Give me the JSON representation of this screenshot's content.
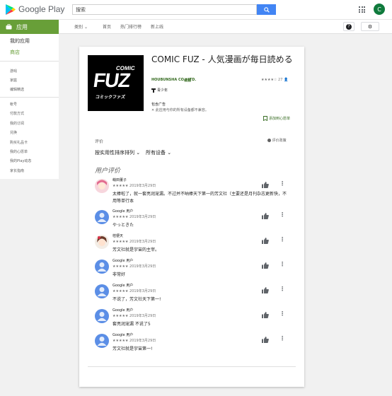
{
  "header": {
    "brand": "Google Play",
    "search_value": "搜索",
    "avatar_initial": "C"
  },
  "subnav": {
    "apps_tab": "应用",
    "category": "类别",
    "home": "首页",
    "top_charts": "热门排行榜",
    "new": "新上线"
  },
  "sidebar": {
    "my_apps": "我的应用",
    "store": "商店",
    "sub_items": [
      "游戏",
      "家庭",
      "编辑精选"
    ],
    "account_items": [
      "帐号",
      "付款方式",
      "我的订阅",
      "兑换",
      "购买礼品卡",
      "我的心愿单",
      "我的Play动态",
      "家长指南"
    ]
  },
  "app": {
    "title": "COMIC FUZ - 人気漫画が毎日読める",
    "cover_top": "COMIC",
    "cover_main": "FUZ",
    "cover_bottom": "コミックファズ",
    "developer": "HOUBUNSHA CO., LTD.",
    "category": "漫画",
    "rating_stars": "★★★★☆",
    "rating_count": "27",
    "age_rating": "青少年",
    "contains_ads": "包含广告",
    "compat_note": "此应用与你的所有设备都不兼容。",
    "wishlist": "添加到心愿单"
  },
  "reviews": {
    "section_label": "评价",
    "policy": "评价政策",
    "sort": "按实用性排序排列",
    "devices": "所有设备",
    "heading": "用户评价",
    "items": [
      {
        "name": "萌田董子",
        "stars": "★★★★★",
        "date": "2019年3月29日",
        "text": "太棒啦了，就一套亮润宠漏。不过并不呐棒天下第一的芳文社（主要还是月刊杂志更新快，不用等单行本",
        "avatar": "anime"
      },
      {
        "name": "Google 用户",
        "stars": "★★★★★",
        "date": "2019年3月29日",
        "text": "やっときた",
        "avatar": "google"
      },
      {
        "name": "桔梗天",
        "stars": "★★★★★",
        "date": "2019年3月29日",
        "text": "芳文社就是宇宙的主宰。",
        "avatar": "anime2"
      },
      {
        "name": "Google 用户",
        "stars": "★★★★★",
        "date": "2019年3月29日",
        "text": "非常好",
        "avatar": "google"
      },
      {
        "name": "Google 用户",
        "stars": "★★★★★",
        "date": "2019年3月29日",
        "text": "不说了，芳文社天下第一!",
        "avatar": "google"
      },
      {
        "name": "Google 用户",
        "stars": "★★★★★",
        "date": "2019年3月29日",
        "text": "套亮润宠漏 不说了5",
        "avatar": "google"
      },
      {
        "name": "Google 用户",
        "stars": "★★★★★",
        "date": "2019年3月29日",
        "text": "芳文社就是宇宙第一!",
        "avatar": "google"
      }
    ]
  },
  "colors": {
    "brand_green": "#689f38",
    "dark_green": "#33691e",
    "search_blue": "#4285f4"
  }
}
